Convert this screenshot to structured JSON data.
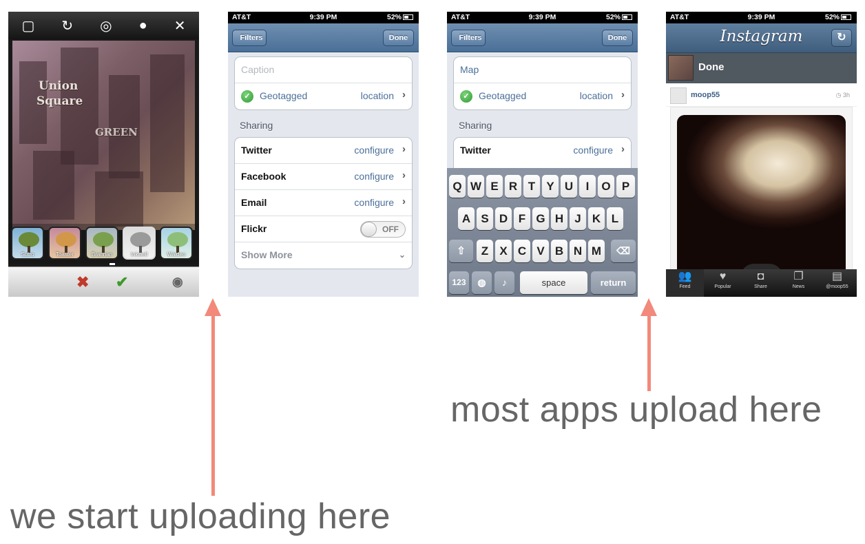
{
  "screen1": {
    "toolbar_icons": [
      "crop-icon",
      "rotate-icon",
      "tilt-shift-icon",
      "blur-drop-icon",
      "close-icon"
    ],
    "map_labels": [
      "Union",
      "Square",
      "GREEN"
    ],
    "filters": [
      {
        "name": "Sutro",
        "color": "#6a8a3a"
      },
      {
        "name": "Toaster",
        "color": "#d2984a"
      },
      {
        "name": "Brannan",
        "color": "#7aa04e"
      },
      {
        "name": "Inkwell",
        "color": "#9a9a9a"
      },
      {
        "name": "Walden",
        "color": "#8ebf7a"
      }
    ],
    "bottom_icons": [
      "cancel-x-icon",
      "accept-check-icon",
      "eye-icon"
    ]
  },
  "screen2": {
    "status": {
      "carrier": "AT&T",
      "time": "9:39 PM",
      "battery": "52%"
    },
    "nav": {
      "back": "Filters",
      "done": "Done"
    },
    "caption_placeholder": "Caption",
    "geotagged": "Geotagged",
    "location": "location",
    "sharing_header": "Sharing",
    "rows": [
      {
        "label": "Twitter",
        "value": "configure"
      },
      {
        "label": "Facebook",
        "value": "configure"
      },
      {
        "label": "Email",
        "value": "configure"
      }
    ],
    "flickr": "Flickr",
    "flickr_toggle": "OFF",
    "show_more": "Show More"
  },
  "screen3": {
    "status": {
      "carrier": "AT&T",
      "time": "9:39 PM",
      "battery": "52%"
    },
    "nav": {
      "back": "Filters",
      "done": "Done"
    },
    "caption_value": "Map",
    "geotagged": "Geotagged",
    "location": "location",
    "sharing_header": "Sharing",
    "twitter": "Twitter",
    "twitter_value": "configure",
    "keyboard": {
      "row1": [
        "Q",
        "W",
        "E",
        "R",
        "T",
        "Y",
        "U",
        "I",
        "O",
        "P"
      ],
      "row2": [
        "A",
        "S",
        "D",
        "F",
        "G",
        "H",
        "J",
        "K",
        "L"
      ],
      "row3": [
        "Z",
        "X",
        "C",
        "V",
        "B",
        "N",
        "M"
      ],
      "num": "123",
      "space": "space",
      "return": "return"
    }
  },
  "screen4": {
    "status": {
      "carrier": "AT&T",
      "time": "9:39 PM",
      "battery": "52%"
    },
    "logo": "Instagram",
    "done": "Done",
    "username": "moop55",
    "time_ago": "3h",
    "tabs": [
      "Feed",
      "Popular",
      "Share",
      "News",
      "@moop55"
    ]
  },
  "annotations": {
    "left": "we start uploading here",
    "right": "most apps upload here",
    "arrow_color": "#f2897a"
  }
}
